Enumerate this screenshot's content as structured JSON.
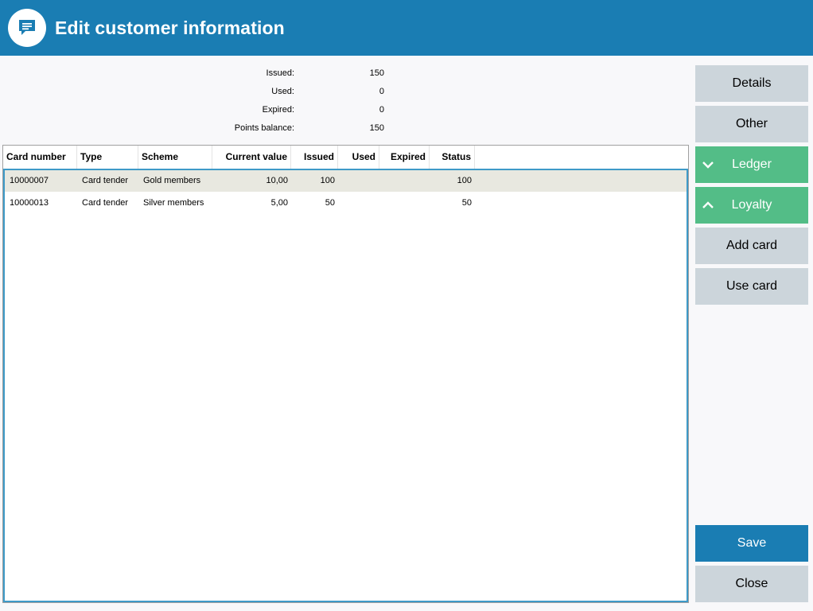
{
  "header": {
    "title": "Edit customer information",
    "icon": "chat-bubble-icon"
  },
  "summary": [
    {
      "label": "Issued:",
      "value": "150"
    },
    {
      "label": "Used:",
      "value": "0"
    },
    {
      "label": "Expired:",
      "value": "0"
    },
    {
      "label": "Points balance:",
      "value": "150"
    }
  ],
  "table": {
    "columns": [
      "Card number",
      "Type",
      "Scheme",
      "Current value",
      "Issued",
      "Used",
      "Expired",
      "Status"
    ],
    "rows": [
      [
        "10000007",
        "Card tender",
        "Gold members",
        "10,00",
        "100",
        "",
        "",
        "100"
      ],
      [
        "10000013",
        "Card tender",
        "Silver members",
        "5,00",
        "50",
        "",
        "",
        "50"
      ]
    ],
    "selected_row": 0
  },
  "sidebar": {
    "details": "Details",
    "other": "Other",
    "ledger": "Ledger",
    "loyalty": "Loyalty",
    "add_card": "Add card",
    "use_card": "Use card",
    "save": "Save",
    "close": "Close"
  },
  "colors": {
    "accent": "#1a7db3",
    "green": "#53bd87",
    "button_gray": "#ccd5db"
  }
}
